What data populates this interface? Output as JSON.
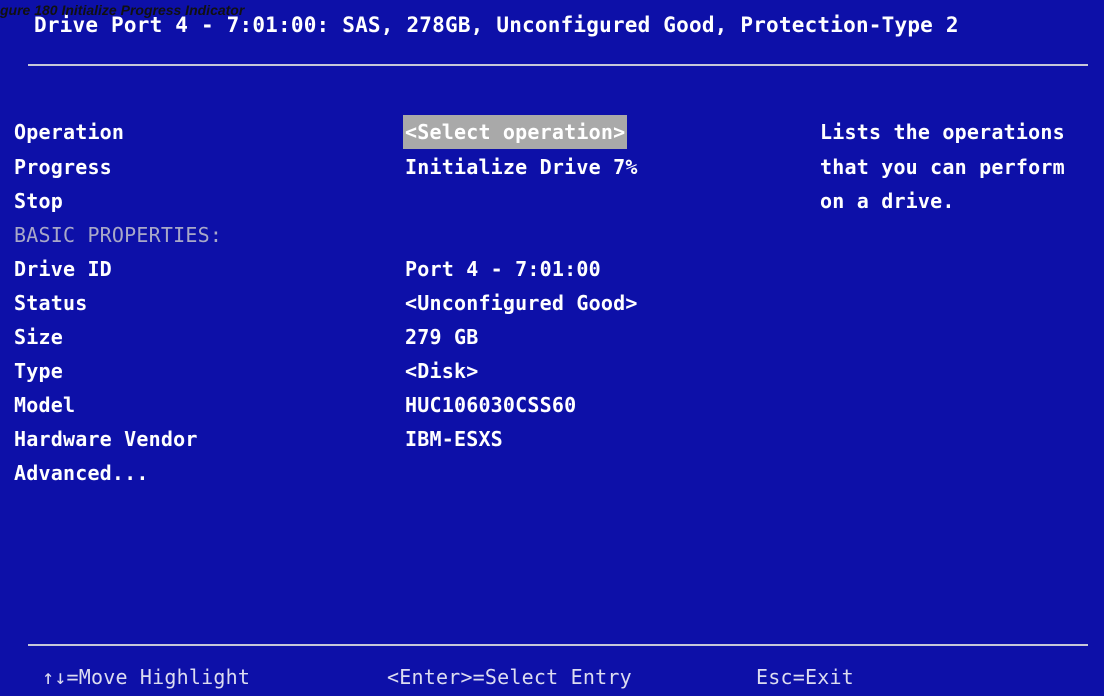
{
  "caption": "gure 180 Initialize Progress Indicator",
  "header": "Drive Port 4 - 7:01:00: SAS, 278GB, Unconfigured Good, Protection-Type 2",
  "rows": {
    "operation": {
      "label": "Operation",
      "value": "<Select operation>"
    },
    "progress": {
      "label": "Progress",
      "value": "Initialize Drive 7%"
    },
    "stop": {
      "label": "Stop"
    },
    "section": "BASIC PROPERTIES:",
    "drive_id": {
      "label": "Drive ID",
      "value": "Port 4 - 7:01:00"
    },
    "status": {
      "label": "Status",
      "value": "<Unconfigured Good>"
    },
    "size": {
      "label": "Size",
      "value": "279 GB"
    },
    "type": {
      "label": "Type",
      "value": "<Disk>"
    },
    "model": {
      "label": "Model",
      "value": "HUC106030CSS60"
    },
    "vendor": {
      "label": "Hardware Vendor",
      "value": "IBM-ESXS"
    },
    "advanced": {
      "label": "Advanced..."
    }
  },
  "help": {
    "line1": "Lists the operations",
    "line2": "that you can perform",
    "line3": "on a drive."
  },
  "footer": {
    "move": "↑↓=Move Highlight",
    "enter": "<Enter>=Select Entry",
    "esc": "Esc=Exit"
  }
}
